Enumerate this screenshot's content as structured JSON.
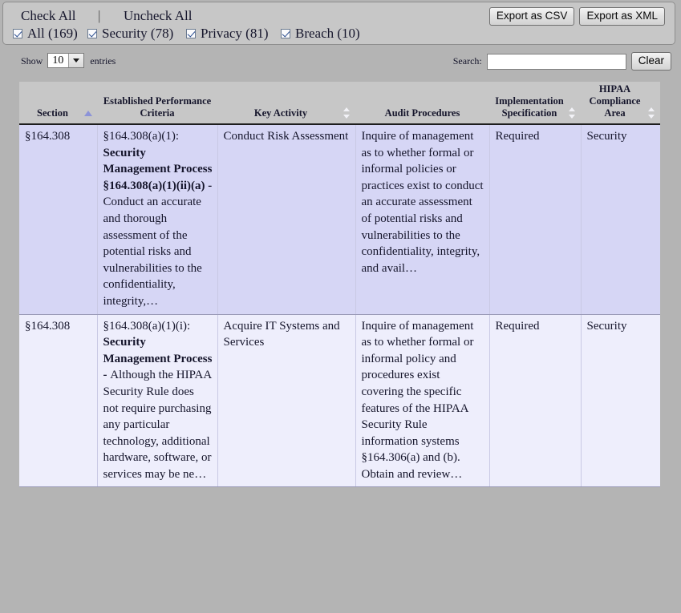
{
  "toolbar": {
    "check_all_label": "Check All",
    "separator": "|",
    "uncheck_all_label": "Uncheck All",
    "export_csv_label": "Export as CSV",
    "export_xml_label": "Export as XML"
  },
  "filters": [
    {
      "label": "All (169)",
      "checked": true,
      "name": "all"
    },
    {
      "label": "Security (78)",
      "checked": true,
      "name": "security"
    },
    {
      "label": "Privacy (81)",
      "checked": true,
      "name": "privacy"
    },
    {
      "label": "Breach (10)",
      "checked": true,
      "name": "breach"
    }
  ],
  "controls": {
    "show_label": "Show",
    "entries_value": "10",
    "entries_suffix": "entries",
    "search_label": "Search:",
    "search_value": "",
    "search_placeholder": "",
    "clear_label": "Clear"
  },
  "table": {
    "columns": [
      {
        "label": "Section",
        "sort": "asc"
      },
      {
        "label": "Established Performance Criteria",
        "sort": "none-hidden"
      },
      {
        "label": "Key Activity",
        "sort": "none"
      },
      {
        "label": "Audit Procedures",
        "sort": "none-hidden"
      },
      {
        "label": "Implementation Specification",
        "sort": "none"
      },
      {
        "label": "HIPAA Compliance Area",
        "sort": "none"
      }
    ],
    "rows": [
      {
        "section": "§164.308",
        "epc_prefix": "§164.308(a)(1): ",
        "epc_bold": "Security Management Process §164.308(a)(1)(ii)(a) - ",
        "epc_rest": "Conduct an accurate and thorough assessment of the potential risks and vulnerabilities to the confidentiality, integrity,…",
        "key_activity": "Conduct Risk Assessment",
        "audit_procedures": "Inquire of management as to whether formal or informal policies or practices exist to conduct an accurate assessment of potential risks and vulnerabilities to the confidentiality, integrity, and avail…",
        "implementation_specification": "Required",
        "hipaa_compliance_area": "Security"
      },
      {
        "section": "§164.308",
        "epc_prefix": "§164.308(a)(1)(i): ",
        "epc_bold": "Security Management Process - ",
        "epc_rest": "Although the HIPAA Security Rule does not require purchasing any particular technology, additional hardware, software, or services may be ne…",
        "key_activity": "Acquire IT Systems and Services",
        "audit_procedures": "Inquire of management as to whether formal or informal policy and procedures exist covering the specific features of the HIPAA Security Rule information systems §164.306(a) and (b). Obtain and review…",
        "implementation_specification": "Required",
        "hipaa_compliance_area": "Security"
      }
    ]
  },
  "colors": {
    "page_background": "#b4b4b4",
    "panel_background": "#c7c7c7",
    "row_odd": "#d6d6f5",
    "row_even": "#eeeefc",
    "sort_active": "#8c93d8",
    "text": "#15152b"
  }
}
